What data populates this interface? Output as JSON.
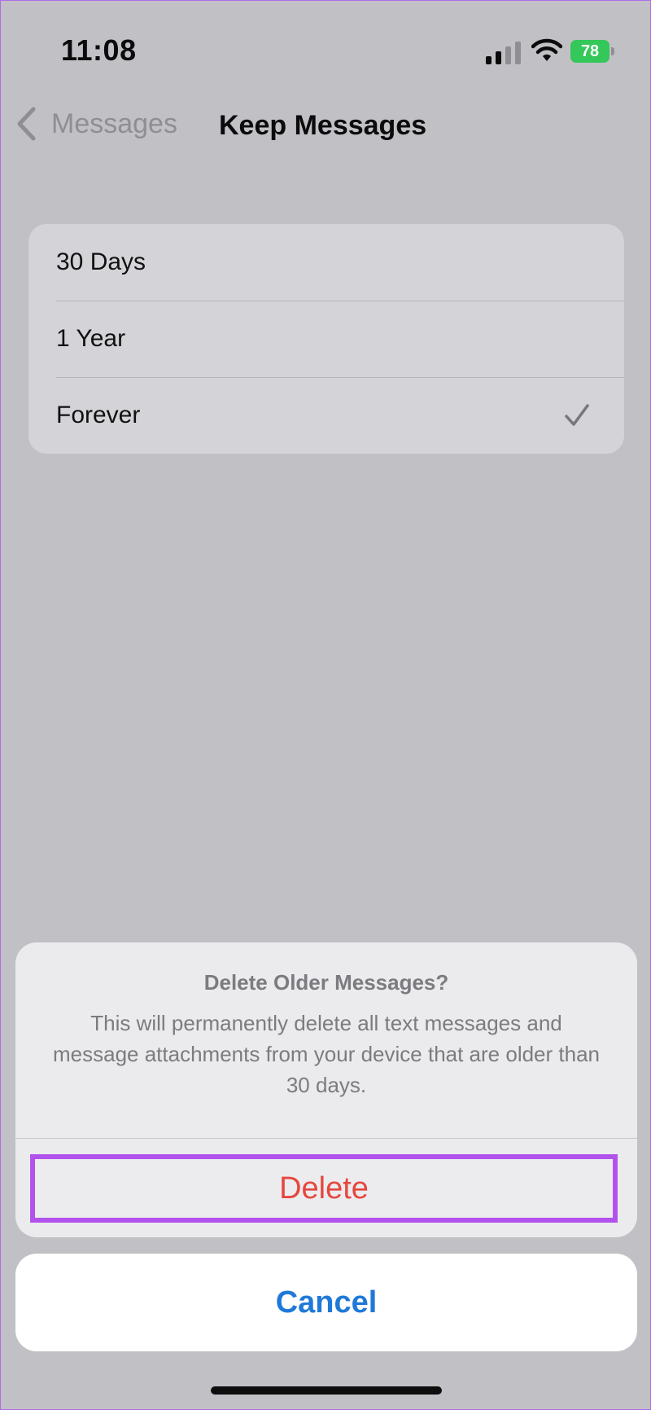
{
  "status_bar": {
    "time": "11:08",
    "battery_level": "78",
    "battery_color": "#34c759"
  },
  "nav": {
    "back_label": "Messages",
    "title": "Keep Messages"
  },
  "options": {
    "items": [
      {
        "label": "30 Days",
        "selected": false
      },
      {
        "label": "1 Year",
        "selected": false
      },
      {
        "label": "Forever",
        "selected": true
      }
    ]
  },
  "action_sheet": {
    "title": "Delete Older Messages?",
    "message": "This will permanently delete all text messages and message attachments from your device that are older than 30 days.",
    "delete_label": "Delete",
    "cancel_label": "Cancel",
    "destructive_color": "#e5473f",
    "accent_color": "#1e79d8",
    "highlight_color": "#b252ec"
  },
  "icons": {
    "back": "chevron-left-icon",
    "check": "checkmark-icon",
    "signal": "cellular-signal-icon",
    "wifi": "wifi-icon",
    "battery": "battery-charging-icon"
  }
}
